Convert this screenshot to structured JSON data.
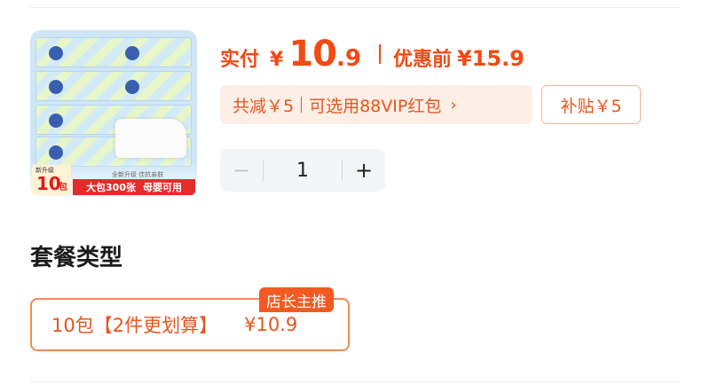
{
  "product": {
    "image": {
      "count_caption": "新升级",
      "count_number": "10",
      "count_unit": "包",
      "upgrade_text": "全新升级 佳抗亲肤",
      "banner_left": "大包300张",
      "banner_right": "母婴可用"
    }
  },
  "price": {
    "label": "实付",
    "currency": "¥",
    "integer": "10",
    "decimal": ".9",
    "original_label": "优惠前",
    "original_price": "¥15.9"
  },
  "promo": {
    "discount_text": "共减￥5",
    "redpacket_text": "可选用88VIP红包",
    "chevron": "›",
    "subsidy_text": "补贴￥5"
  },
  "quantity": {
    "minus": "−",
    "value": "1",
    "plus": "+"
  },
  "package": {
    "section_title": "套餐类型",
    "options": [
      {
        "label": "10包【2件更划算】",
        "price": "¥10.9",
        "tag": "店长主推"
      }
    ]
  },
  "colors": {
    "accent": "#f24a13",
    "chip_bg": "#fdeee6",
    "option_border": "#f08a54"
  }
}
